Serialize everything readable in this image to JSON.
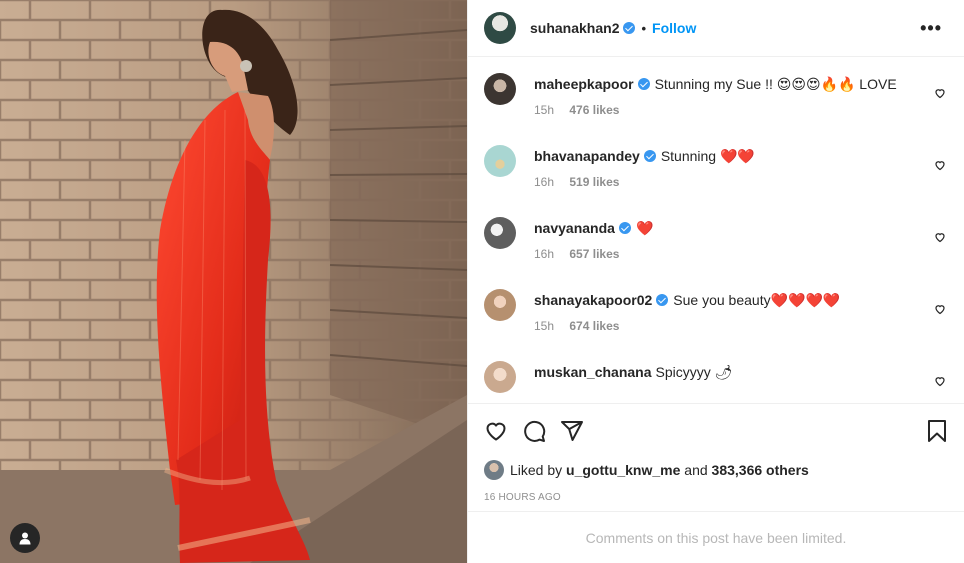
{
  "post": {
    "author": "suhanakhan2",
    "follow_label": "Follow",
    "separator": "•",
    "more_label": "•••"
  },
  "comments": [
    {
      "user": "maheepkapoor",
      "verified": true,
      "text": "Stunning my Sue !! 😍😍😍🔥🔥 LOVE",
      "time": "15h",
      "likes": "476 likes"
    },
    {
      "user": "bhavanapandey",
      "verified": true,
      "text": "Stunning ❤️❤️",
      "time": "16h",
      "likes": "519 likes"
    },
    {
      "user": "navyananda",
      "verified": true,
      "text": "❤️",
      "time": "16h",
      "likes": "657 likes"
    },
    {
      "user": "shanayakapoor02",
      "verified": true,
      "text": "Sue you beauty❤️❤️❤️❤️",
      "time": "15h",
      "likes": "674 likes"
    },
    {
      "user": "muskan_chanana",
      "verified": false,
      "text": "Spicyyyy 🌶",
      "time": "",
      "likes": ""
    }
  ],
  "liked_by": {
    "prefix": "Liked by",
    "user": "u_gottu_knw_me",
    "and": "and",
    "others": "383,366 others"
  },
  "timestamp": "16 HOURS AGO",
  "comments_limited": "Comments on this post have been limited.",
  "icons": {
    "like": "heart-outline-icon",
    "comment": "comment-bubble-icon",
    "share": "paper-plane-icon",
    "save": "bookmark-icon",
    "user_tag": "user-tag-icon"
  },
  "colors": {
    "accent": "#0095f6",
    "verified": "#3897f0",
    "saree": "#e8321f",
    "muted_text": "#8e8e8e"
  }
}
